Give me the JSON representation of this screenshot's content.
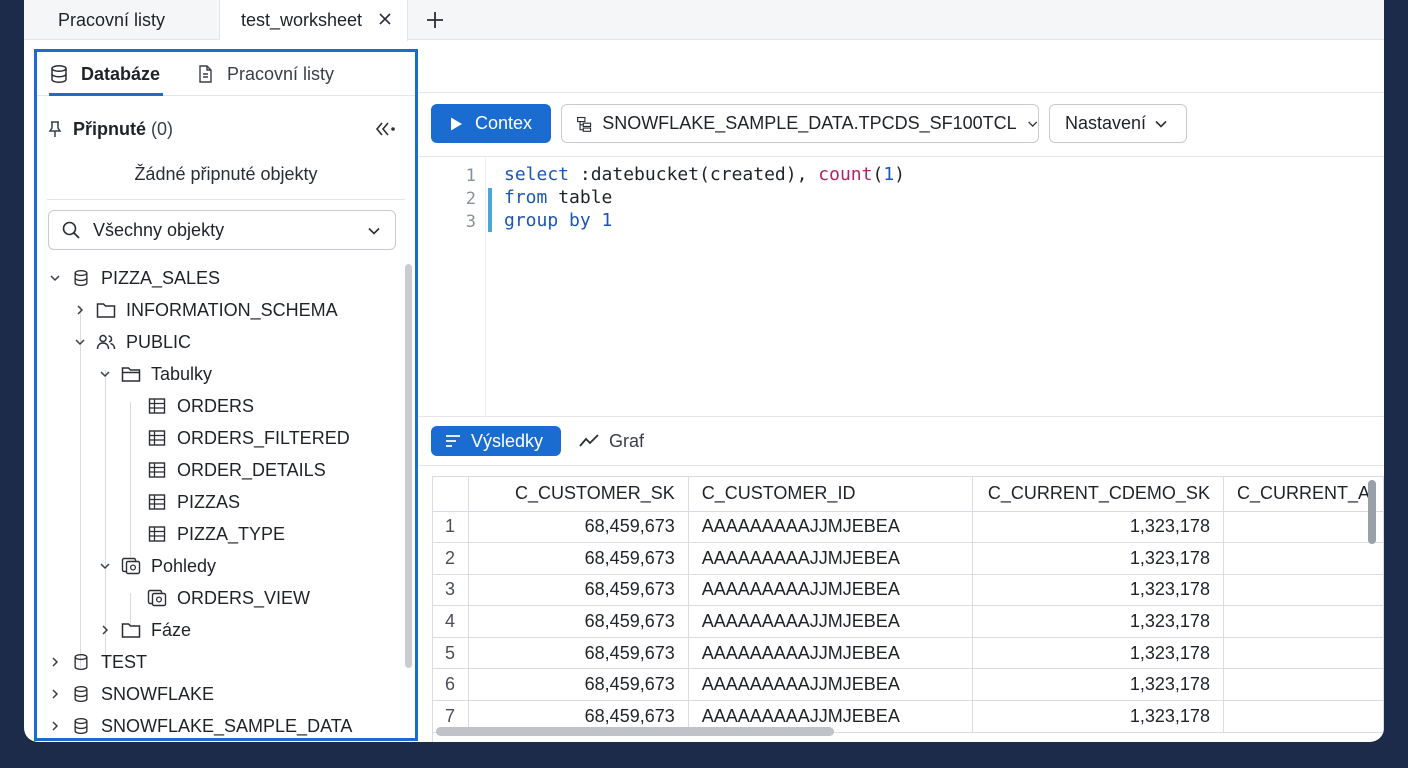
{
  "tabs": {
    "worksheets": "Pracovní listy",
    "active": "test_worksheet"
  },
  "left_panel": {
    "tab_databases": "Databáze",
    "tab_worksheets": "Pracovní listy",
    "pinned_label": "Připnuté",
    "pinned_count": "(0)",
    "no_pinned": "Žádné připnuté objekty",
    "filter_value": "Všechny objekty",
    "tree": {
      "pizza_sales": "PIZZA_SALES",
      "information_schema": "INFORMATION_SCHEMA",
      "public": "PUBLIC",
      "tables": "Tabulky",
      "table_items": [
        "ORDERS",
        "ORDERS_FILTERED",
        "ORDER_DETAILS",
        "PIZZAS",
        "PIZZA_TYPE"
      ],
      "views": "Pohledy",
      "view_items": [
        "ORDERS_VIEW"
      ],
      "stages": "Fáze",
      "test": "TEST",
      "snowflake": "SNOWFLAKE",
      "snowflake_sample_data": "SNOWFLAKE_SAMPLE_DATA"
    }
  },
  "toolbar": {
    "run_label": "Contex",
    "context_value": "SNOWFLAKE_SAMPLE_DATA.TPCDS_SF100TCL",
    "settings_label": "Nastavení"
  },
  "editor": {
    "line_numbers": [
      "1",
      "2",
      "3"
    ]
  },
  "results": {
    "tab_results": "Výsledky",
    "tab_chart": "Graf",
    "columns": [
      "C_CUSTOMER_SK",
      "C_CUSTOMER_ID",
      "C_CURRENT_CDEMO_SK",
      "C_CURRENT_A"
    ],
    "rows": [
      [
        "1",
        "68,459,673",
        "AAAAAAAAAJJMJEBEA",
        "1,323,178"
      ],
      [
        "2",
        "68,459,673",
        "AAAAAAAAAJJMJEBEA",
        "1,323,178"
      ],
      [
        "3",
        "68,459,673",
        "AAAAAAAAAJJMJEBEA",
        "1,323,178"
      ],
      [
        "4",
        "68,459,673",
        "AAAAAAAAAJJMJEBEA",
        "1,323,178"
      ],
      [
        "5",
        "68,459,673",
        "AAAAAAAAAJJMJEBEA",
        "1,323,178"
      ],
      [
        "6",
        "68,459,673",
        "AAAAAAAAAJJMJEBEA",
        "1,323,178"
      ],
      [
        "7",
        "68,459,673",
        "AAAAAAAAAJJMJEBEA",
        "1,323,178"
      ]
    ]
  },
  "colors": {
    "accent": "#1a6cd1",
    "keyword": "#1a56b8",
    "function": "#b0236b",
    "background": "#1d2b4a"
  }
}
